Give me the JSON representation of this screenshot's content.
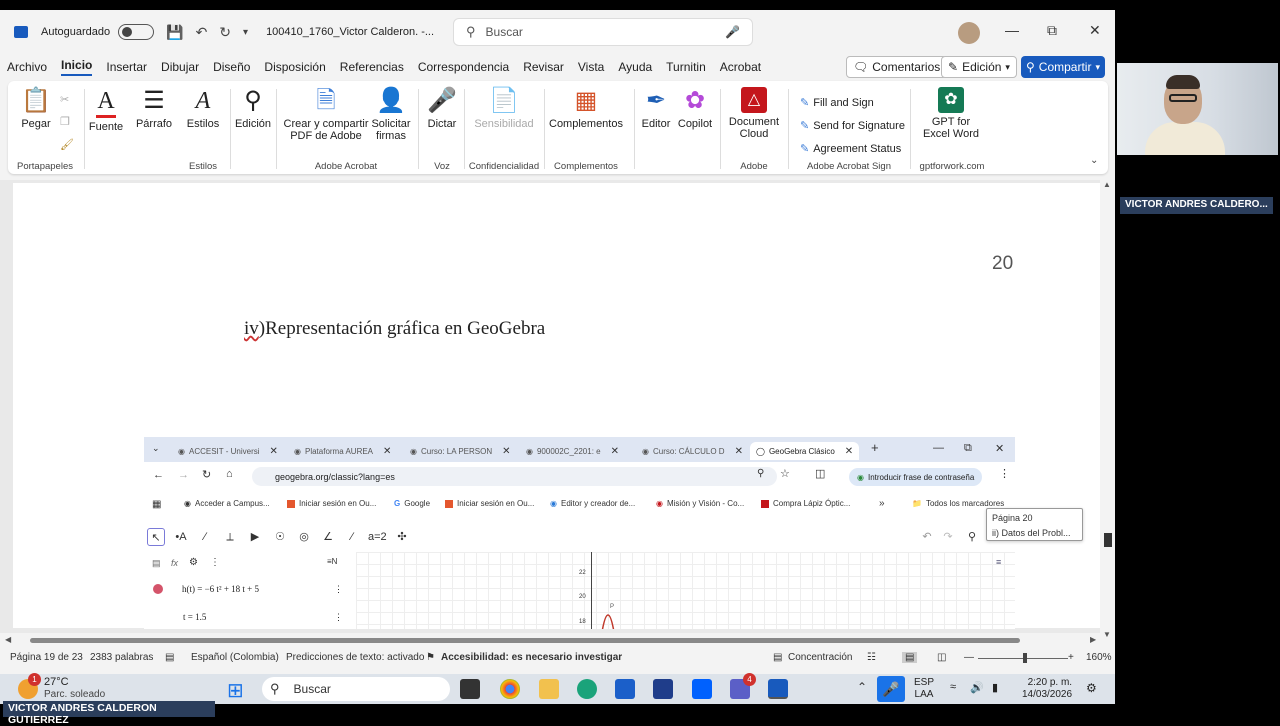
{
  "word": {
    "autosave_label": "Autoguardado",
    "doc_name": "100410_1760_Victor Calderon. -...",
    "search_placeholder": "Buscar",
    "menu": [
      "Archivo",
      "Inicio",
      "Insertar",
      "Dibujar",
      "Diseño",
      "Disposición",
      "Referencias",
      "Correspondencia",
      "Revisar",
      "Vista",
      "Ayuda",
      "Turnitin",
      "Acrobat"
    ],
    "comments_label": "Comentarios",
    "edit_label": "Edición",
    "share_label": "Compartir",
    "ribbon": {
      "paste": "Pegar",
      "font": "Fuente",
      "paragraph": "Párrafo",
      "styles": "Estilos",
      "editing": "Edición",
      "create_share_pdf": "Crear y compartir",
      "create_share_pdf_2": "PDF de Adobe",
      "request_signatures": "Solicitar",
      "request_signatures_2": "firmas",
      "dictate": "Dictar",
      "sensitivity": "Sensibilidad",
      "addins": "Complementos",
      "editor": "Editor",
      "copilot": "Copilot",
      "doc_cloud": "Document",
      "doc_cloud_2": "Cloud",
      "fill_sign": "Fill and Sign",
      "send_sig": "Send for Signature",
      "agreement": "Agreement Status",
      "gpt": "GPT for",
      "gpt_2": "Excel Word",
      "groups": {
        "clipboard": "Portapapeles",
        "styles": "Estilos",
        "adobe_acrobat": "Adobe Acrobat",
        "voice": "Voz",
        "confidentiality": "Confidencialidad",
        "addins": "Complementos",
        "adobe": "Adobe",
        "adobe_sign": "Adobe Acrobat Sign",
        "gpt_site": "gptforwork.com"
      }
    },
    "page_number": "20",
    "heading_prefix": "iv",
    "heading_rest": ")Representación gráfica en GeoGebra",
    "tooltip_line1": "Página 20",
    "tooltip_line2": "ii) Datos del Probl...",
    "status": {
      "page": "Página 19 de 23",
      "words": "2383 palabras",
      "language": "Español (Colombia)",
      "predictions": "Predicciones de texto: activado",
      "accessibility": "Accesibilidad: es necesario investigar",
      "focus": "Concentración",
      "zoom": "160%"
    }
  },
  "browser": {
    "tabs": [
      "ACCESIT - Universi",
      "Plataforma AUREA",
      "Curso: LA PERSON",
      "900002C_2201: e",
      "Curso: CÁLCULO D",
      "GeoGebra Clásico"
    ],
    "url": "geogebra.org/classic?lang=es",
    "passphrase": "Introducir frase de contraseña",
    "bookmarks": [
      "Acceder a Campus...",
      "Iniciar sesión en Ou...",
      "Google",
      "Iniciar sesión en Ou...",
      "Editor y creador de...",
      "Misión y Visión - Co...",
      "Compra Lápiz Óptic..."
    ],
    "all_bookmarks": "Todos los marcadores",
    "algebra": {
      "h_expr": "h(t) = −6 t² + 18 t + 5",
      "t_expr": "t = 1.5"
    },
    "y_ticks": [
      "22",
      "20",
      "18"
    ],
    "point_label": "P"
  },
  "taskbar": {
    "weather_temp": "27°C",
    "weather_desc": "Parc. soleado",
    "search": "Buscar",
    "lang_1": "ESP",
    "lang_2": "LAA",
    "time": "2:20 p. m.",
    "date": "14/03/2026",
    "badge_1": "1",
    "badge_4": "4"
  },
  "captions": {
    "bottom": "VICTOR ANDRES CALDERON GUTIERREZ",
    "right": "VICTOR ANDRES CALDERO..."
  },
  "colors": {
    "word_blue": "#185abd",
    "caption_bg": "#2b3e5c"
  }
}
